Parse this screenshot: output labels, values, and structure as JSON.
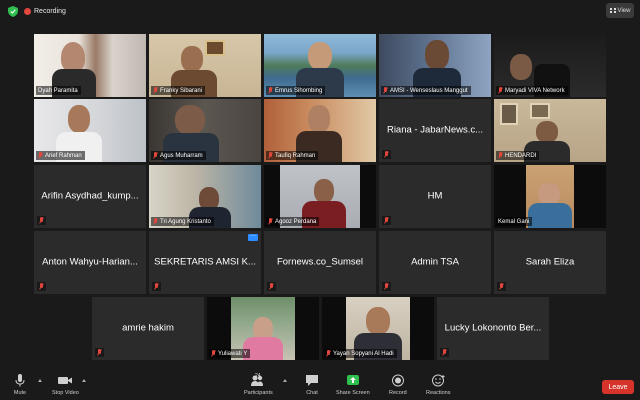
{
  "topbar": {
    "recording_label": "Recording",
    "view_label": "View"
  },
  "participants": {
    "video": [
      {
        "name": "Dyah Paramita"
      },
      {
        "name": "Franky Sibarani"
      },
      {
        "name": "Emrus Sihombing"
      },
      {
        "name": "AMSI - Wenseslaus Manggut"
      },
      {
        "name": "Maryadi VIVA Network"
      },
      {
        "name": "Arief Rahman"
      },
      {
        "name": "Agus Muharram"
      },
      {
        "name": "Taufiq Rahman"
      },
      {
        "name": "HENDARDI"
      },
      {
        "name": "Tri Agung Kristanto"
      },
      {
        "name": "Agooz Perdana"
      },
      {
        "name": "Kemal Gani"
      },
      {
        "name": "Yuliawati Y"
      },
      {
        "name": "Yayan Sopyani Al Hadi"
      }
    ],
    "name_only": [
      {
        "name": "Riana - JabarNews.c..."
      },
      {
        "name": "Arifin Asydhad_kump..."
      },
      {
        "name": "HM"
      },
      {
        "name": "Anton Wahyu-Harian..."
      },
      {
        "name": "SEKRETARIS AMSI K..."
      },
      {
        "name": "Fornews.co_Sumsel"
      },
      {
        "name": "Admin TSA"
      },
      {
        "name": "Sarah Eliza"
      },
      {
        "name": "amrie hakim"
      },
      {
        "name": "Lucky Lokononto Ber..."
      }
    ]
  },
  "toolbar": {
    "mute": "Mute",
    "stop_video": "Stop Video",
    "participants": "Participants",
    "participants_count": "24",
    "chat": "Chat",
    "share_screen": "Share Screen",
    "record": "Record",
    "reactions": "Reactions",
    "leave": "Leave"
  },
  "colors": {
    "leave": "#d6342b",
    "share_screen": "#2fbf4f",
    "active_speaker": "#d8e23a",
    "muted": "#e0473d"
  }
}
